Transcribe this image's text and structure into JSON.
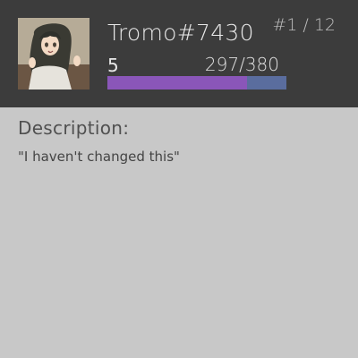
{
  "profile": {
    "username": "Tromo#7430",
    "rank": "#1 / 12",
    "level": "5",
    "xp_text": "297/380",
    "xp_current": 297,
    "xp_max": 380,
    "avatar_alt": "avatar"
  },
  "description": {
    "heading": "Description:",
    "text": "\"I haven't changed this\""
  },
  "colors": {
    "header_bg": "#3c3c3c",
    "body_bg": "#c8c8c8",
    "xp_fill": "#8a56b9",
    "xp_track": "#5a6d9e"
  }
}
